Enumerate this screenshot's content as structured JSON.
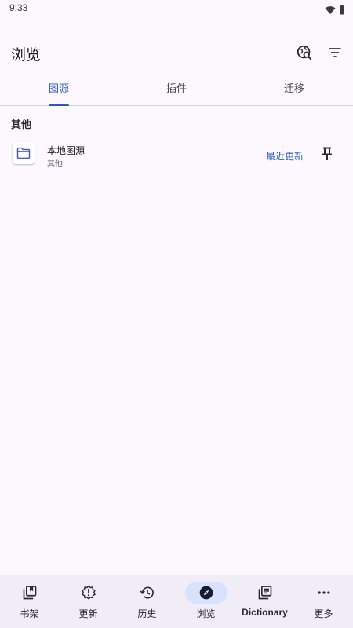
{
  "status_bar": {
    "time": "9:33",
    "icons": [
      "wifi-icon",
      "battery-icon"
    ]
  },
  "app_bar": {
    "title": "浏览",
    "actions": [
      "global-search-icon",
      "filter-icon"
    ]
  },
  "tabs": [
    {
      "label": "图源",
      "active": true
    },
    {
      "label": "插件",
      "active": false
    },
    {
      "label": "迁移",
      "active": false
    }
  ],
  "section": {
    "title": "其他"
  },
  "sources": [
    {
      "icon": "folder-icon",
      "name": "本地图源",
      "language": "其他",
      "latest_label": "最近更新",
      "pin_icon": "pin-icon"
    }
  ],
  "bottom_nav": [
    {
      "label": "书架",
      "icon": "library-icon",
      "active": false
    },
    {
      "label": "更新",
      "icon": "updates-icon",
      "active": false
    },
    {
      "label": "历史",
      "icon": "history-icon",
      "active": false
    },
    {
      "label": "浏览",
      "icon": "compass-icon",
      "active": true
    },
    {
      "label": "Dictionary",
      "icon": "dictionary-icon",
      "active": false
    },
    {
      "label": "更多",
      "icon": "more-icon",
      "active": false
    }
  ],
  "colors": {
    "background": "#fcf8fd",
    "accent": "#2a5bc0",
    "nav_background": "#f1edf6",
    "nav_active_pill": "#d8e2ff"
  }
}
